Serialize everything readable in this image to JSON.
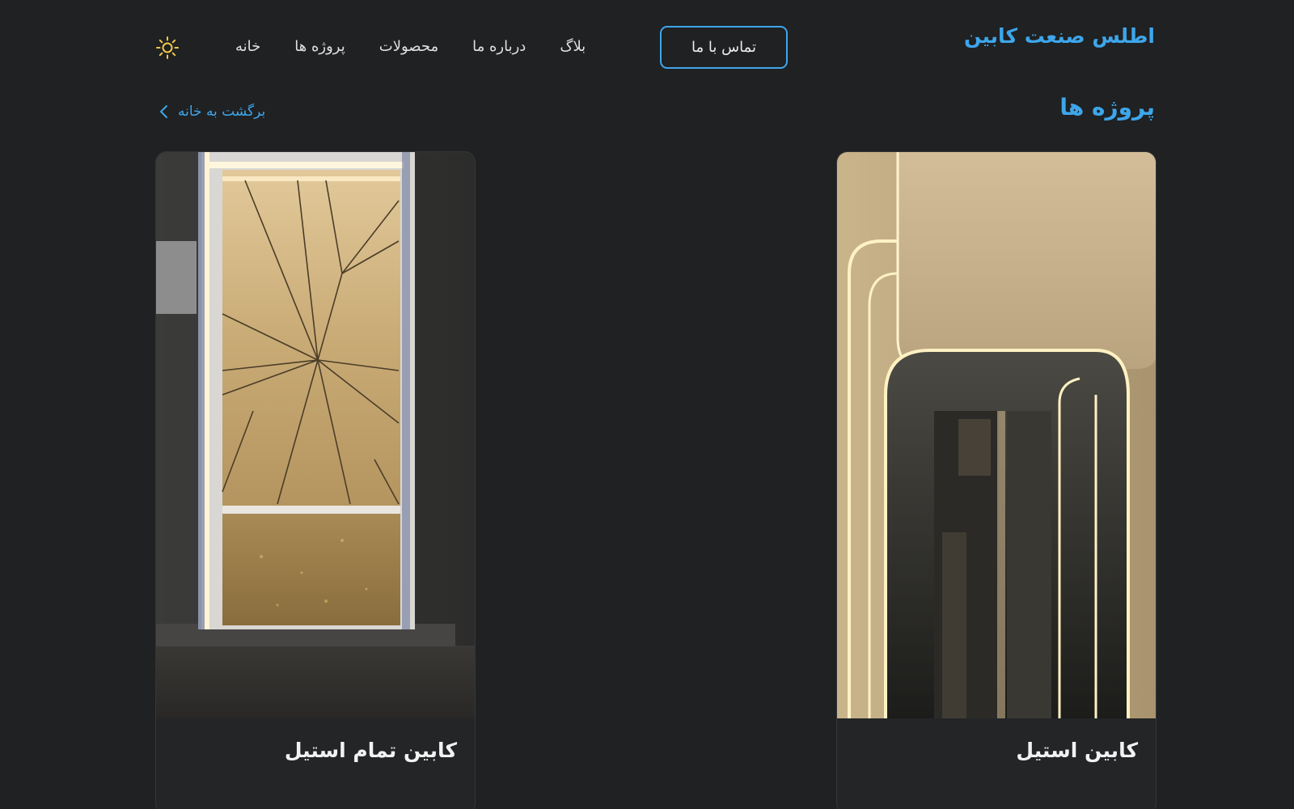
{
  "brand": {
    "name": "اطلس صنعت کابین"
  },
  "header": {
    "contact_label": "تماس با ما",
    "nav": [
      {
        "label": "خانه"
      },
      {
        "label": "پروژه ها"
      },
      {
        "label": "محصولات"
      },
      {
        "label": "درباره ما"
      },
      {
        "label": "بلاگ"
      }
    ],
    "theme_icon": "sun-icon"
  },
  "page": {
    "title": "پروژه ها",
    "back_label": "برگشت به خانه",
    "back_icon": "chevron-left-icon"
  },
  "projects": [
    {
      "title": "کابین استیل"
    },
    {
      "title": "کابین تمام استیل"
    }
  ],
  "colors": {
    "background": "#1f2123",
    "accent": "#3ea6ea",
    "card": "#232527",
    "sun": "#f2c94c"
  }
}
